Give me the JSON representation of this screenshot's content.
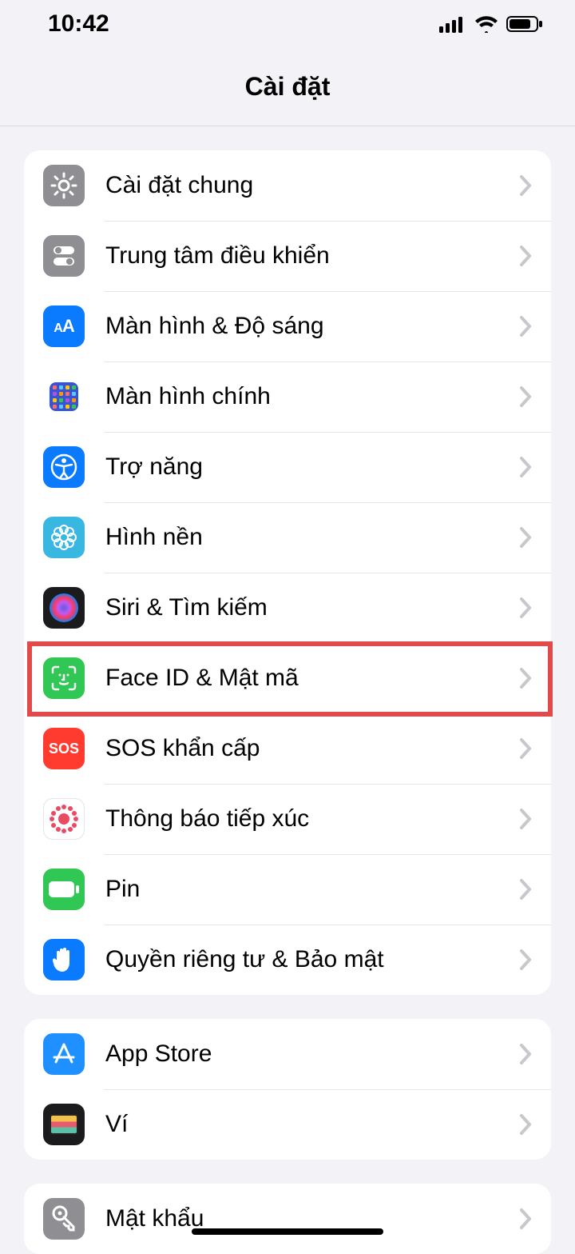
{
  "status": {
    "time": "10:42"
  },
  "title": "Cài đặt",
  "groups": [
    {
      "items": [
        {
          "id": "general",
          "label": "Cài đặt chung",
          "icon": "gear",
          "bg": "#8e8e93"
        },
        {
          "id": "control-center",
          "label": "Trung tâm điều khiển",
          "icon": "toggles",
          "bg": "#8e8e93"
        },
        {
          "id": "display",
          "label": "Màn hình & Độ sáng",
          "icon": "aa",
          "bg": "#0a7aff"
        },
        {
          "id": "home-screen",
          "label": "Màn hình chính",
          "icon": "grid",
          "bg": "#3854d1"
        },
        {
          "id": "accessibility",
          "label": "Trợ năng",
          "icon": "accessibility",
          "bg": "#0a7aff"
        },
        {
          "id": "wallpaper",
          "label": "Hình nền",
          "icon": "flower",
          "bg": "#38b7e0"
        },
        {
          "id": "siri",
          "label": "Siri & Tìm kiếm",
          "icon": "siri",
          "bg": "#1b1b1d"
        },
        {
          "id": "face-id",
          "label": "Face ID & Mật mã",
          "icon": "faceid",
          "bg": "#30c754",
          "highlighted": true
        },
        {
          "id": "sos",
          "label": "SOS khẩn cấp",
          "icon": "sos",
          "bg": "#ff3b30"
        },
        {
          "id": "exposure",
          "label": "Thông báo tiếp xúc",
          "icon": "exposure",
          "bg": "#ffffff"
        },
        {
          "id": "battery",
          "label": "Pin",
          "icon": "battery",
          "bg": "#30c754"
        },
        {
          "id": "privacy",
          "label": "Quyền riêng tư & Bảo mật",
          "icon": "hand",
          "bg": "#0a7aff"
        }
      ]
    },
    {
      "items": [
        {
          "id": "app-store",
          "label": "App Store",
          "icon": "appstore",
          "bg": "#1e90ff"
        },
        {
          "id": "wallet",
          "label": "Ví",
          "icon": "wallet",
          "bg": "#1b1b1d"
        }
      ]
    },
    {
      "items": [
        {
          "id": "passwords",
          "label": "Mật khẩu",
          "icon": "key",
          "bg": "#8e8e93"
        }
      ]
    }
  ]
}
